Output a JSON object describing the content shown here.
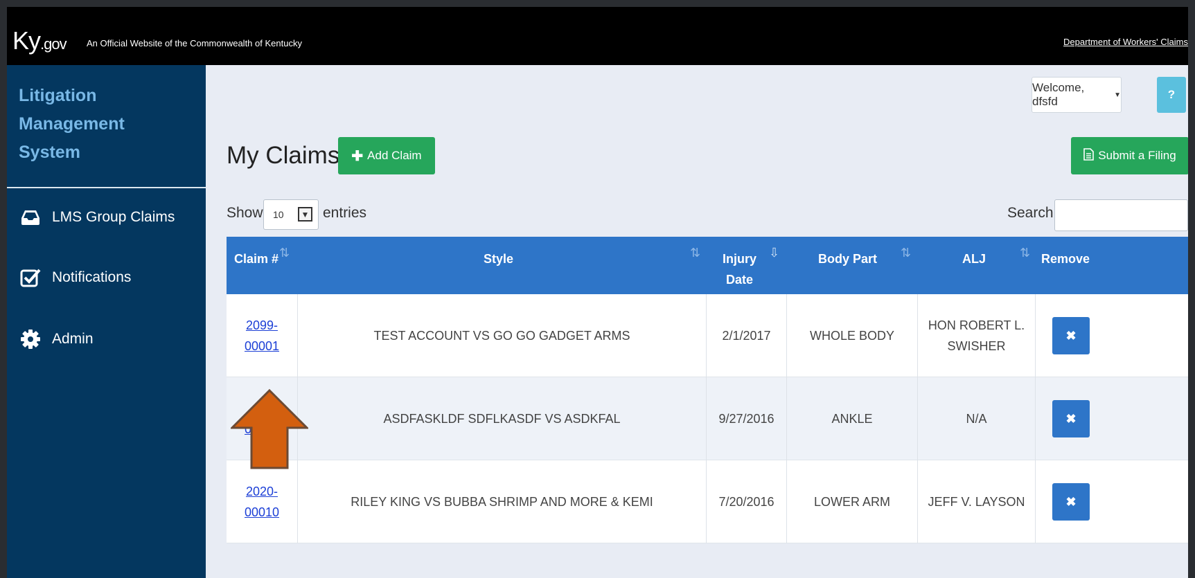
{
  "header": {
    "logo_ky": "Ky",
    "logo_gov": ".gov",
    "official": "An Official Website of the Commonwealth of Kentucky",
    "dept_link": "Department of Workers' Claims"
  },
  "sidebar": {
    "brand_lines": [
      "Litigation",
      "Management",
      "System"
    ],
    "items": [
      {
        "label": "LMS Group Claims",
        "icon": "inbox-icon"
      },
      {
        "label": "Notifications",
        "icon": "checkbox-icon"
      },
      {
        "label": "Admin",
        "icon": "gear-icon"
      }
    ]
  },
  "topright": {
    "welcome": "Welcome, dfsfd",
    "help": "?"
  },
  "main": {
    "title": "My Claims",
    "add_claim": "Add Claim",
    "submit_filing": "Submit a Filing",
    "show_label": "Show",
    "page_size": "10",
    "entries_label": "entries",
    "search_label": "Search:",
    "search_value": ""
  },
  "table": {
    "headers": {
      "claim": "Claim #",
      "style": "Style",
      "injury1": "Injury",
      "injury2": "Date",
      "body": "Body Part",
      "alj": "ALJ",
      "remove": "Remove"
    },
    "rows": [
      {
        "claim1": "2099-",
        "claim2": "00001",
        "style": "TEST ACCOUNT VS GO GO GADGET ARMS",
        "date": "2/1/2017",
        "body": "WHOLE BODY",
        "alj1": "HON ROBERT L.",
        "alj2": "SWISHER"
      },
      {
        "claim1": "",
        "claim2": "00012",
        "style": "ASDFASKLDF SDFLKASDF VS ASDKFAL",
        "date": "9/27/2016",
        "body": "ANKLE",
        "alj1": "N/A",
        "alj2": ""
      },
      {
        "claim1": "2020-",
        "claim2": "00010",
        "style": "RILEY KING VS BUBBA SHRIMP AND MORE & KEMI",
        "date": "7/20/2016",
        "body": "LOWER ARM",
        "alj1": "JEFF V. LAYSON",
        "alj2": ""
      }
    ]
  },
  "colors": {
    "topbar": "#000000",
    "sidebar": "#04375f",
    "brand": "#79b8e6",
    "table_header": "#2e75c8",
    "green_button": "#26a65b",
    "help_button": "#5bc0de",
    "annotation_arrow": "#d35f0f"
  }
}
